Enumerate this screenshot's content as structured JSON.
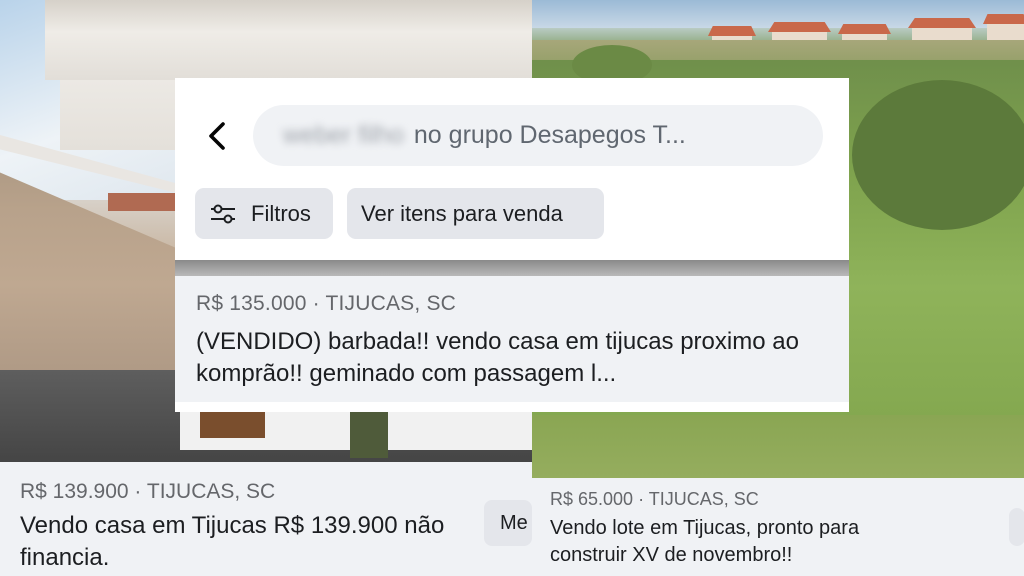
{
  "search": {
    "blurred_user": "weber filho",
    "text": "no grupo Desapegos T..."
  },
  "chips": {
    "filters_label": "Filtros",
    "sale_label": "Ver itens para venda"
  },
  "featured_listing": {
    "price_location": "R$ 135.000 · TIJUCAS, SC",
    "title": "(VENDIDO) barbada!! vendo casa em tijucas proximo ao komprão!! geminado com passagem l..."
  },
  "listings": [
    {
      "price_location": "R$ 139.900 · TIJUCAS, SC",
      "title": "Vendo casa em Tijucas R$ 139.900 não financia.",
      "button_label": "Me"
    },
    {
      "price_location": "R$ 65.000 · TIJUCAS, SC",
      "title": "Vendo lote em Tijucas, pronto para construir XV de novembro!!",
      "button_label": ""
    }
  ],
  "icons": {
    "back": "chevron-left-icon",
    "filter": "sliders-icon"
  },
  "colors": {
    "card_bg": "#f0f2f5",
    "chip_bg": "#e4e6eb",
    "text_primary": "#1c1e21",
    "text_secondary": "#65676b"
  }
}
